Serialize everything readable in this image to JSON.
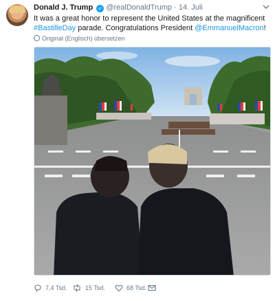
{
  "tweet": {
    "author_name": "Donald J. Trump",
    "verified_badge": "✓",
    "handle": "@realDonaldTrump",
    "separator": "·",
    "date": "14. Juli",
    "text_part1": "It was a great honor to represent the United States at the magnificent ",
    "hashtag": "#BastilleDay",
    "text_part2": " parade. Congratulations President ",
    "mention": "@EmmanuelMacron",
    "text_part3": "!",
    "translate_label": "Original (Englisch) übersetzen",
    "actions": {
      "replies": "7,4 Tsd.",
      "retweets": "15 Tsd.",
      "likes": "68 Tsd."
    }
  },
  "colors": {
    "link": "#1b95e0",
    "verified": "#1da1f2",
    "muted": "#657786"
  },
  "icons": [
    "avatar",
    "verified-icon",
    "chevron-down-icon",
    "globe-icon",
    "reply-icon",
    "retweet-icon",
    "like-icon",
    "message-icon"
  ]
}
